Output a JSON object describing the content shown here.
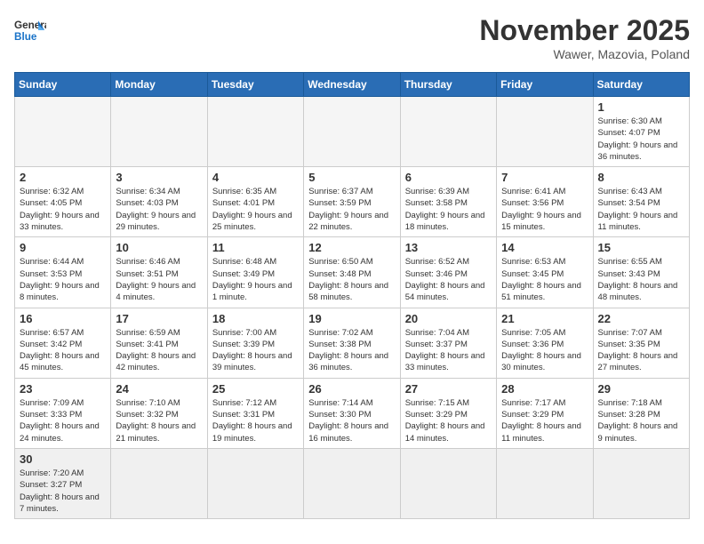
{
  "logo": {
    "text_general": "General",
    "text_blue": "Blue"
  },
  "header": {
    "month_title": "November 2025",
    "location": "Wawer, Mazovia, Poland"
  },
  "days_of_week": [
    "Sunday",
    "Monday",
    "Tuesday",
    "Wednesday",
    "Thursday",
    "Friday",
    "Saturday"
  ],
  "weeks": [
    [
      {
        "day": "",
        "info": "",
        "empty": true
      },
      {
        "day": "",
        "info": "",
        "empty": true
      },
      {
        "day": "",
        "info": "",
        "empty": true
      },
      {
        "day": "",
        "info": "",
        "empty": true
      },
      {
        "day": "",
        "info": "",
        "empty": true
      },
      {
        "day": "",
        "info": "",
        "empty": true
      },
      {
        "day": "1",
        "info": "Sunrise: 6:30 AM\nSunset: 4:07 PM\nDaylight: 9 hours\nand 36 minutes."
      }
    ],
    [
      {
        "day": "2",
        "info": "Sunrise: 6:32 AM\nSunset: 4:05 PM\nDaylight: 9 hours\nand 33 minutes."
      },
      {
        "day": "3",
        "info": "Sunrise: 6:34 AM\nSunset: 4:03 PM\nDaylight: 9 hours\nand 29 minutes."
      },
      {
        "day": "4",
        "info": "Sunrise: 6:35 AM\nSunset: 4:01 PM\nDaylight: 9 hours\nand 25 minutes."
      },
      {
        "day": "5",
        "info": "Sunrise: 6:37 AM\nSunset: 3:59 PM\nDaylight: 9 hours\nand 22 minutes."
      },
      {
        "day": "6",
        "info": "Sunrise: 6:39 AM\nSunset: 3:58 PM\nDaylight: 9 hours\nand 18 minutes."
      },
      {
        "day": "7",
        "info": "Sunrise: 6:41 AM\nSunset: 3:56 PM\nDaylight: 9 hours\nand 15 minutes."
      },
      {
        "day": "8",
        "info": "Sunrise: 6:43 AM\nSunset: 3:54 PM\nDaylight: 9 hours\nand 11 minutes."
      }
    ],
    [
      {
        "day": "9",
        "info": "Sunrise: 6:44 AM\nSunset: 3:53 PM\nDaylight: 9 hours\nand 8 minutes."
      },
      {
        "day": "10",
        "info": "Sunrise: 6:46 AM\nSunset: 3:51 PM\nDaylight: 9 hours\nand 4 minutes."
      },
      {
        "day": "11",
        "info": "Sunrise: 6:48 AM\nSunset: 3:49 PM\nDaylight: 9 hours\nand 1 minute."
      },
      {
        "day": "12",
        "info": "Sunrise: 6:50 AM\nSunset: 3:48 PM\nDaylight: 8 hours\nand 58 minutes."
      },
      {
        "day": "13",
        "info": "Sunrise: 6:52 AM\nSunset: 3:46 PM\nDaylight: 8 hours\nand 54 minutes."
      },
      {
        "day": "14",
        "info": "Sunrise: 6:53 AM\nSunset: 3:45 PM\nDaylight: 8 hours\nand 51 minutes."
      },
      {
        "day": "15",
        "info": "Sunrise: 6:55 AM\nSunset: 3:43 PM\nDaylight: 8 hours\nand 48 minutes."
      }
    ],
    [
      {
        "day": "16",
        "info": "Sunrise: 6:57 AM\nSunset: 3:42 PM\nDaylight: 8 hours\nand 45 minutes."
      },
      {
        "day": "17",
        "info": "Sunrise: 6:59 AM\nSunset: 3:41 PM\nDaylight: 8 hours\nand 42 minutes."
      },
      {
        "day": "18",
        "info": "Sunrise: 7:00 AM\nSunset: 3:39 PM\nDaylight: 8 hours\nand 39 minutes."
      },
      {
        "day": "19",
        "info": "Sunrise: 7:02 AM\nSunset: 3:38 PM\nDaylight: 8 hours\nand 36 minutes."
      },
      {
        "day": "20",
        "info": "Sunrise: 7:04 AM\nSunset: 3:37 PM\nDaylight: 8 hours\nand 33 minutes."
      },
      {
        "day": "21",
        "info": "Sunrise: 7:05 AM\nSunset: 3:36 PM\nDaylight: 8 hours\nand 30 minutes."
      },
      {
        "day": "22",
        "info": "Sunrise: 7:07 AM\nSunset: 3:35 PM\nDaylight: 8 hours\nand 27 minutes."
      }
    ],
    [
      {
        "day": "23",
        "info": "Sunrise: 7:09 AM\nSunset: 3:33 PM\nDaylight: 8 hours\nand 24 minutes."
      },
      {
        "day": "24",
        "info": "Sunrise: 7:10 AM\nSunset: 3:32 PM\nDaylight: 8 hours\nand 21 minutes."
      },
      {
        "day": "25",
        "info": "Sunrise: 7:12 AM\nSunset: 3:31 PM\nDaylight: 8 hours\nand 19 minutes."
      },
      {
        "day": "26",
        "info": "Sunrise: 7:14 AM\nSunset: 3:30 PM\nDaylight: 8 hours\nand 16 minutes."
      },
      {
        "day": "27",
        "info": "Sunrise: 7:15 AM\nSunset: 3:29 PM\nDaylight: 8 hours\nand 14 minutes."
      },
      {
        "day": "28",
        "info": "Sunrise: 7:17 AM\nSunset: 3:29 PM\nDaylight: 8 hours\nand 11 minutes."
      },
      {
        "day": "29",
        "info": "Sunrise: 7:18 AM\nSunset: 3:28 PM\nDaylight: 8 hours\nand 9 minutes."
      }
    ],
    [
      {
        "day": "30",
        "info": "Sunrise: 7:20 AM\nSunset: 3:27 PM\nDaylight: 8 hours\nand 7 minutes.",
        "last": true
      },
      {
        "day": "",
        "info": "",
        "empty": true,
        "last": true
      },
      {
        "day": "",
        "info": "",
        "empty": true,
        "last": true
      },
      {
        "day": "",
        "info": "",
        "empty": true,
        "last": true
      },
      {
        "day": "",
        "info": "",
        "empty": true,
        "last": true
      },
      {
        "day": "",
        "info": "",
        "empty": true,
        "last": true
      },
      {
        "day": "",
        "info": "",
        "empty": true,
        "last": true
      }
    ]
  ]
}
